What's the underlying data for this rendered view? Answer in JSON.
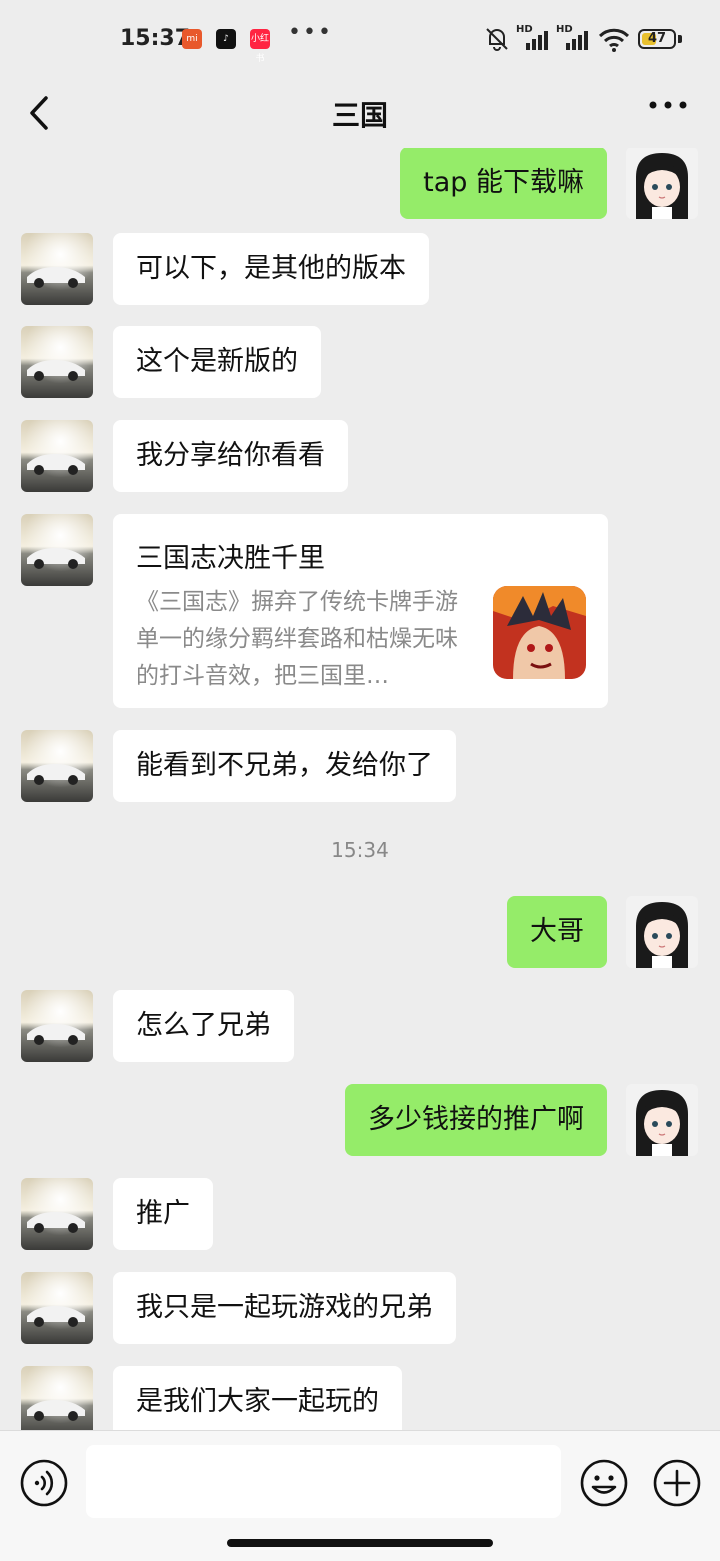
{
  "status_bar": {
    "time": "15:37",
    "app_icons": [
      "mi-icon",
      "tiktok-icon",
      "xiaohongshu-icon"
    ],
    "overflow": "•••",
    "battery": "47",
    "battery_level": 0.47,
    "signal_1": "HD",
    "signal_2": "HD"
  },
  "header": {
    "title": "三国"
  },
  "messages": [
    {
      "side": "out",
      "text": "tap 能下载嘛"
    },
    {
      "side": "in",
      "text": "可以下，是其他的版本"
    },
    {
      "side": "in",
      "text": "这个是新版的"
    },
    {
      "side": "in",
      "text": "我分享给你看看"
    },
    {
      "side": "in",
      "type": "card",
      "title": "三国志决胜千里",
      "desc": "《三国志》摒弃了传统卡牌手游单一的缘分羁绊套路和枯燥无味的打斗音效，把三国里…"
    },
    {
      "side": "in",
      "text": "能看到不兄弟，发给你了"
    },
    {
      "type": "time",
      "text": "15:34"
    },
    {
      "side": "out",
      "text": "大哥"
    },
    {
      "side": "in",
      "text": "怎么了兄弟"
    },
    {
      "side": "out",
      "text": "多少钱接的推广啊"
    },
    {
      "side": "in",
      "text": "推广"
    },
    {
      "side": "in",
      "text": "我只是一起玩游戏的兄弟"
    },
    {
      "side": "in",
      "text": "是我们大家一起玩的"
    }
  ],
  "input": {
    "placeholder": "",
    "value": ""
  },
  "colors": {
    "background": "#ededed",
    "outgoing_bubble": "#95ec69",
    "incoming_bubble": "#ffffff",
    "time_text": "#888888"
  }
}
